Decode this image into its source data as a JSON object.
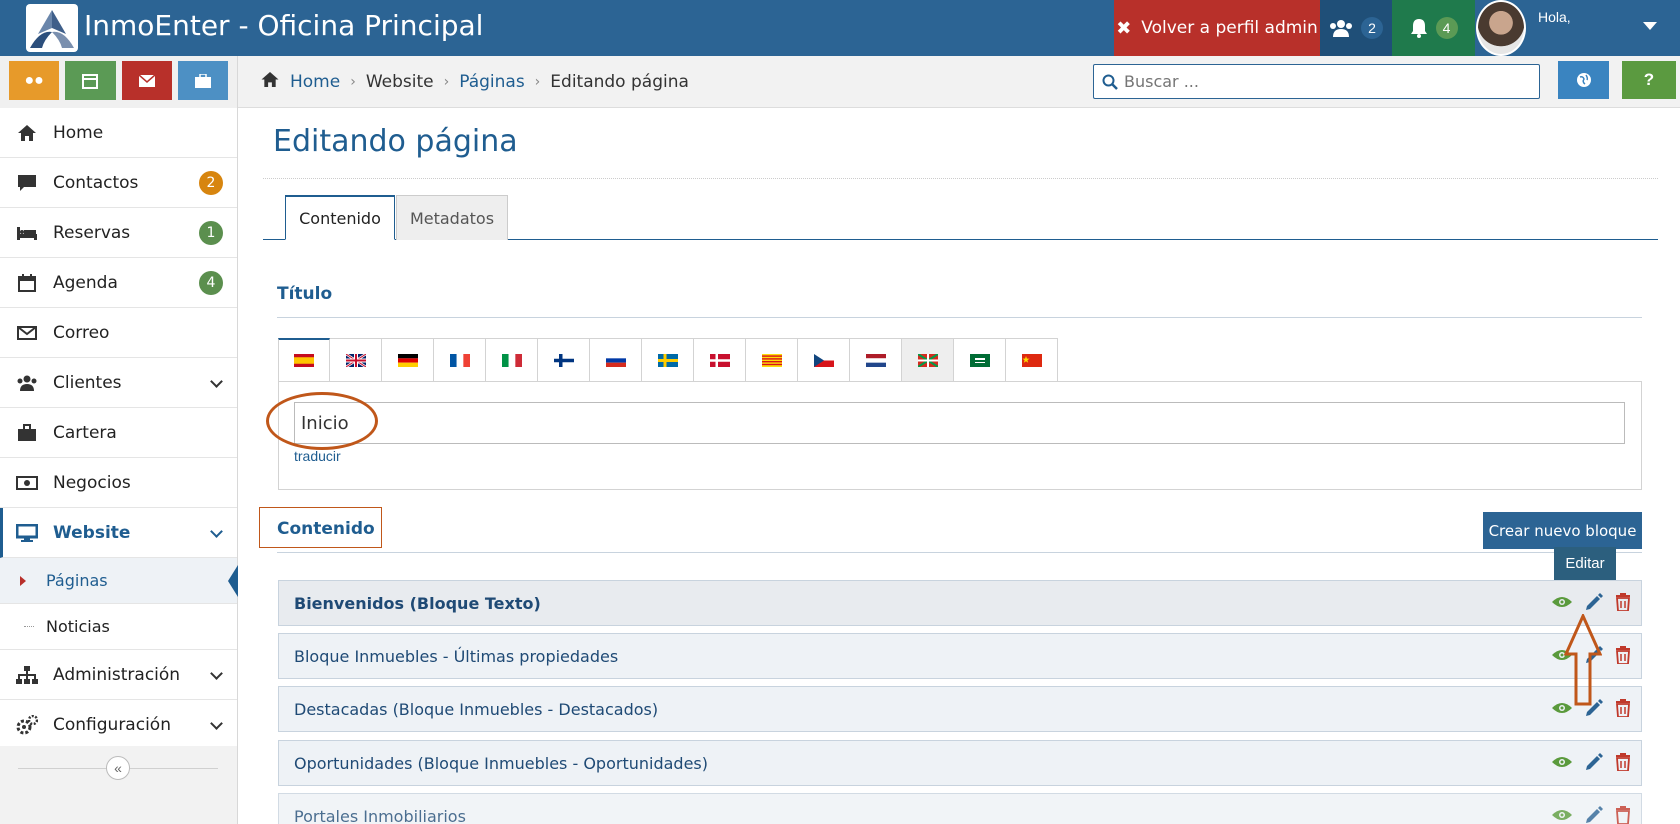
{
  "app": {
    "title": "InmoEnter - Oficina Principal",
    "admin_button": "Volver a perfil admin",
    "users_count": "2",
    "notifications_count": "4",
    "greeting": "Hola,"
  },
  "sidebar": {
    "items": [
      {
        "label": "Home",
        "icon": "home-icon"
      },
      {
        "label": "Contactos",
        "icon": "chat-icon",
        "badge": "2",
        "badge_color": "#d7850f"
      },
      {
        "label": "Reservas",
        "icon": "bed-icon",
        "badge": "1",
        "badge_color": "#5b8f4e"
      },
      {
        "label": "Agenda",
        "icon": "calendar-icon",
        "badge": "4",
        "badge_color": "#5b8f4e"
      },
      {
        "label": "Correo",
        "icon": "envelope-icon"
      },
      {
        "label": "Clientes",
        "icon": "users-icon"
      },
      {
        "label": "Cartera",
        "icon": "briefcase-icon"
      },
      {
        "label": "Negocios",
        "icon": "money-icon"
      },
      {
        "label": "Website",
        "icon": "desktop-icon"
      },
      {
        "label": "Páginas"
      },
      {
        "label": "Noticias"
      },
      {
        "label": "Administración",
        "icon": "sitemap-icon"
      },
      {
        "label": "Configuración",
        "icon": "gears-icon"
      }
    ]
  },
  "breadcrumb": {
    "home": "Home",
    "website": "Website",
    "pages": "Páginas",
    "current": "Editando página"
  },
  "search": {
    "placeholder": "Buscar ..."
  },
  "help_label": "?",
  "page": {
    "title": "Editando página",
    "tabs": [
      "Contenido",
      "Metadatos"
    ],
    "title_section": "Título",
    "title_value": "Inicio",
    "translate_link": "traducir",
    "content_section": "Contenido",
    "new_block_button": "Crear nuevo bloque",
    "tooltip": "Editar",
    "blocks": [
      "Bienvenidos (Bloque Texto)",
      "Bloque Inmuebles - Últimas propiedades",
      "Destacadas (Bloque Inmuebles - Destacados)",
      "Oportunidades (Bloque Inmuebles - Oportunidades)",
      "Portales Inmobiliarios"
    ]
  },
  "colors": {
    "primary": "#2c6494",
    "danger": "#b8302a",
    "success": "#1f7a4c",
    "annotation": "#c0571a"
  }
}
